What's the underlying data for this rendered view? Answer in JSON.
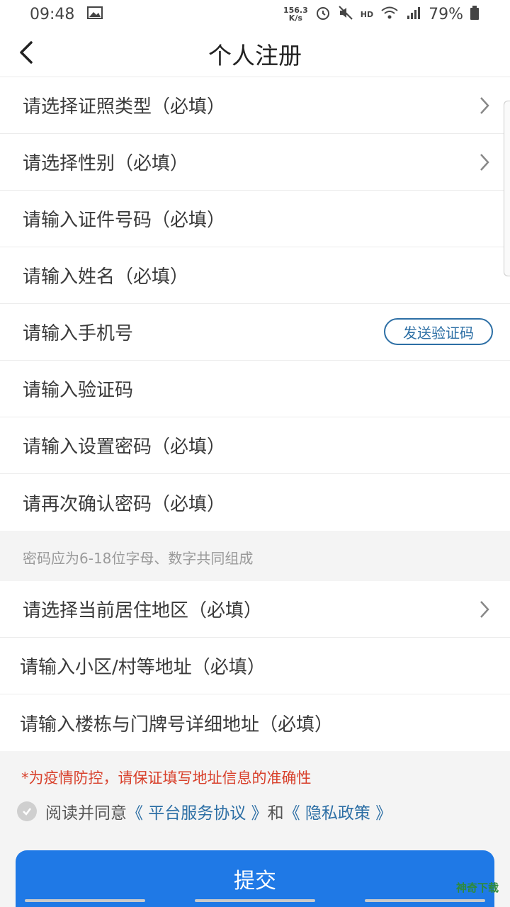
{
  "status": {
    "time": "09:48",
    "netspeed_top": "156.3",
    "netspeed_bottom": "K/s",
    "hd": "HD",
    "battery": "79%"
  },
  "nav": {
    "title": "个人注册"
  },
  "form_top": [
    {
      "label": "请选择证照类型（必填）",
      "chevron": true
    },
    {
      "label": "请选择性别（必填）",
      "chevron": true
    },
    {
      "label": "请输入证件号码（必填）"
    },
    {
      "label": "请输入姓名（必填）"
    },
    {
      "label": "请输入手机号",
      "button": "发送验证码"
    },
    {
      "label": "请输入验证码"
    },
    {
      "label": "请输入设置密码（必填）"
    },
    {
      "label": "请再次确认密码（必填）"
    }
  ],
  "password_hint": "密码应为6-18位字母、数字共同组成",
  "form_bottom": [
    {
      "label": "请选择当前居住地区（必填）",
      "chevron": true
    },
    {
      "label": "请输入小区/村等地址（必填）"
    },
    {
      "label": "请输入楼栋与门牌号详细地址（必填）"
    }
  ],
  "notice": "*为疫情防控，请保证填写地址信息的准确性",
  "agreement": {
    "prefix": "阅读并同意",
    "link1": "《 平台服务协议 》",
    "mid": "和",
    "link2": "《 隐私政策 》"
  },
  "submit_label": "提交",
  "watermark": "神奇下载"
}
